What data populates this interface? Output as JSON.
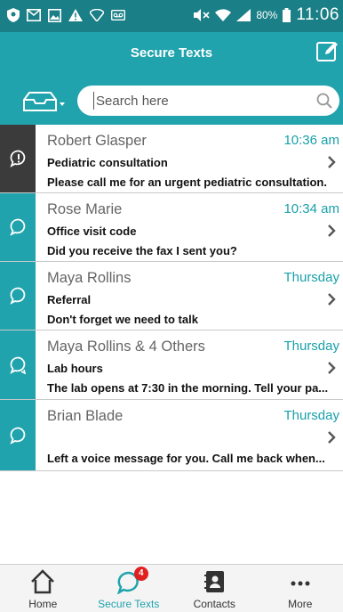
{
  "status_bar": {
    "battery": "80%",
    "time": "11:06"
  },
  "header": {
    "title": "Secure Texts"
  },
  "search": {
    "placeholder": "Search here"
  },
  "messages": [
    {
      "sender": "Robert Glasper",
      "time": "10:36 am",
      "subject": "Pediatric consultation",
      "preview": "Please call me for an urgent pediatric consultation.",
      "urgent": true
    },
    {
      "sender": "Rose Marie",
      "time": "10:34 am",
      "subject": "Office visit code",
      "preview": "Did you receive the fax I sent you?",
      "urgent": false
    },
    {
      "sender": "Maya Rollins",
      "time": "Thursday",
      "subject": "Referral",
      "preview": "Don't forget we need to talk",
      "urgent": false
    },
    {
      "sender": "Maya Rollins & 4 Others",
      "time": "Thursday",
      "subject": "Lab hours",
      "preview": "The lab opens at 7:30 in the morning. Tell your pa...",
      "urgent": false
    },
    {
      "sender": "Brian Blade",
      "time": "Thursday",
      "subject": "",
      "preview": "Left a voice message for you. Call me back when...",
      "urgent": false
    }
  ],
  "nav": {
    "home": "Home",
    "secure_texts": "Secure Texts",
    "secure_texts_badge": "4",
    "contacts": "Contacts",
    "more": "More"
  },
  "colors": {
    "status_bar": "#1a7f86",
    "accent": "#20a3ad",
    "urgent_side": "#3b3b3b",
    "badge": "#e02020"
  }
}
